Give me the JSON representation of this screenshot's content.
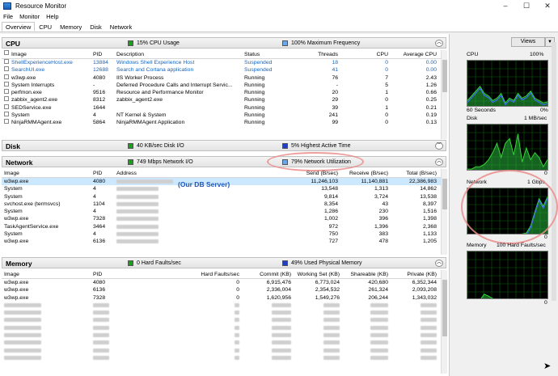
{
  "window": {
    "title": "Resource Monitor"
  },
  "menu": [
    "File",
    "Monitor",
    "Help"
  ],
  "tabs": [
    "Overview",
    "CPU",
    "Memory",
    "Disk",
    "Network"
  ],
  "cpu": {
    "name": "CPU",
    "usage": "15% CPU Usage",
    "freq": "100% Maximum Frequency",
    "columns": [
      "Image",
      "PID",
      "Description",
      "Status",
      "Threads",
      "CPU",
      "Average CPU"
    ],
    "rows": [
      [
        "ShellExperienceHost.exe",
        "13884",
        "Windows Shell Experience Host",
        "Suspended",
        "18",
        "0",
        "0.00"
      ],
      [
        "SearchUI.exe",
        "12688",
        "Search and Cortana application",
        "Suspended",
        "41",
        "0",
        "0.00"
      ],
      [
        "w3wp.exe",
        "4080",
        "IIS Worker Process",
        "Running",
        "76",
        "7",
        "2.43"
      ],
      [
        "System Interrupts",
        "-",
        "Deferred Procedure Calls and Interrupt Servic...",
        "Running",
        "-",
        "5",
        "1.26"
      ],
      [
        "perfmon.exe",
        "9516",
        "Resource and Performance Monitor",
        "Running",
        "20",
        "1",
        "0.66"
      ],
      [
        "zabbix_agent2.exe",
        "8312",
        "zabbix_agent2.exe",
        "Running",
        "29",
        "0",
        "0.25"
      ],
      [
        "SEDService.exe",
        "1644",
        "",
        "Running",
        "39",
        "1",
        "0.21"
      ],
      [
        "System",
        "4",
        "NT Kernel & System",
        "Running",
        "241",
        "0",
        "0.19"
      ],
      [
        "NinjaRMMAgent.exe",
        "5864",
        "NinjaRMMAgent Application",
        "Running",
        "99",
        "0",
        "0.13"
      ]
    ]
  },
  "disk": {
    "name": "Disk",
    "io": "40 KB/sec Disk I/O",
    "active": "5% Highest Active Time"
  },
  "network": {
    "name": "Network",
    "io": "749 Mbps Network I/O",
    "util": "79% Network Utilization",
    "annotation": "(Our DB Server)",
    "columns": [
      "Image",
      "PID",
      "Address",
      "Send (B/sec)",
      "Receive (B/sec)",
      "Total (B/sec)"
    ],
    "rows": [
      [
        "w3wp.exe",
        "4080",
        "11,246,103",
        "11,140,881",
        "22,386,983"
      ],
      [
        "System",
        "4",
        "13,548",
        "1,313",
        "14,862"
      ],
      [
        "System",
        "4",
        "9,814",
        "3,724",
        "13,538"
      ],
      [
        "svchost.exe (termsvcs)",
        "1104",
        "8,354",
        "43",
        "8,397"
      ],
      [
        "System",
        "4",
        "1,286",
        "230",
        "1,516"
      ],
      [
        "w3wp.exe",
        "7328",
        "1,002",
        "396",
        "1,398"
      ],
      [
        "TaskAgentService.exe",
        "3464",
        "972",
        "1,396",
        "2,368"
      ],
      [
        "System",
        "4",
        "750",
        "383",
        "1,133"
      ],
      [
        "w3wp.exe",
        "6136",
        "727",
        "478",
        "1,205"
      ]
    ]
  },
  "memory": {
    "name": "Memory",
    "faults": "0 Hard Faults/sec",
    "used": "49% Used Physical Memory",
    "columns": [
      "Image",
      "PID",
      "Hard Faults/sec",
      "Commit (KB)",
      "Working Set (KB)",
      "Shareable (KB)",
      "Private (KB)"
    ],
    "rows": [
      [
        "w3wp.exe",
        "4080",
        "0",
        "6,915,476",
        "6,773,024",
        "420,680",
        "6,352,344"
      ],
      [
        "w3wp.exe",
        "6136",
        "0",
        "2,336,004",
        "2,354,532",
        "261,324",
        "2,093,208"
      ],
      [
        "w3wp.exe",
        "7328",
        "0",
        "1,620,956",
        "1,549,276",
        "206,244",
        "1,343,032"
      ]
    ]
  },
  "side": {
    "views": "Views",
    "cpu": {
      "label": "CPU",
      "max": "100%",
      "footer": "60 Seconds",
      "min": "0%",
      "level": [
        0.15,
        0.25,
        0.35,
        0.45,
        0.3,
        0.25,
        0.15,
        0.2,
        0.3,
        0.1,
        0.2,
        0.15,
        0.3,
        0.2,
        0.25,
        0.35,
        0.2,
        0.15,
        0.1,
        0.12
      ]
    },
    "disk": {
      "label": "Disk",
      "max": "1 MB/sec",
      "min": "0",
      "level": [
        0.05,
        0.05,
        0.1,
        0.1,
        0.15,
        0.25,
        0.4,
        0.6,
        0.3,
        0.6,
        0.7,
        0.35,
        0.8,
        0.2,
        0.5,
        0.25,
        0.4,
        0.3,
        0.1,
        0.25
      ]
    },
    "network": {
      "label": "Network",
      "max": "1 Gbps",
      "min": "0",
      "level": [
        0.02,
        0.02,
        0.02,
        0.02,
        0.02,
        0.02,
        0.02,
        0.02,
        0.02,
        0.02,
        0.02,
        0.02,
        0.02,
        0.03,
        0.05,
        0.2,
        0.5,
        0.78,
        0.62,
        0.82
      ]
    },
    "memory": {
      "label": "Memory",
      "max": "100 Hard Faults/sec",
      "min": "0",
      "level": [
        0.0,
        0.0,
        0.0,
        0.0,
        0.12,
        0.08,
        0.03,
        0.02,
        0.02,
        0.02,
        0.02,
        0.02,
        0.02,
        0.02,
        0.02,
        0.02,
        0.02,
        0.02,
        0.02,
        0.02
      ]
    }
  }
}
